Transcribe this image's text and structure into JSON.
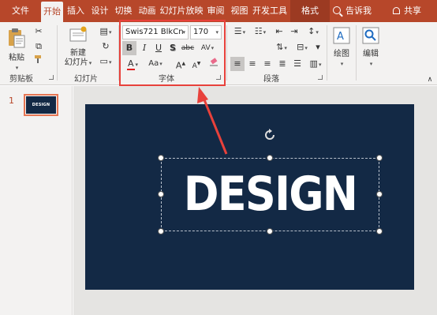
{
  "tabs": [
    "文件",
    "开始",
    "插入",
    "设计",
    "切换",
    "动画",
    "幻灯片放映",
    "审阅",
    "视图",
    "开发工具",
    "格式"
  ],
  "tell_me": "告诉我",
  "share": "共享",
  "groups": {
    "clipboard": {
      "label": "剪贴板",
      "paste": "粘贴"
    },
    "slides": {
      "label": "幻灯片",
      "new_slide_line1": "新建",
      "new_slide_line2": "幻灯片"
    },
    "font": {
      "label": "字体",
      "font_name": "Swis721 BlkCn",
      "font_size": "170",
      "bold": "B",
      "italic": "I",
      "underline": "U",
      "shadow": "S",
      "strike": "abc",
      "spacing": "AV",
      "font_color": "A",
      "change_case": "Aa",
      "grow": "A",
      "shrink": "A"
    },
    "paragraph": {
      "label": "段落"
    },
    "drawing": {
      "label": "绘图"
    },
    "editing": {
      "label": "编辑"
    }
  },
  "thumbnail": {
    "number": "1",
    "text": "DESIGN"
  },
  "slide": {
    "title_text": "DESIGN"
  },
  "colors": {
    "accent": "#b7472a",
    "slide_bg": "#132945",
    "highlight": "#e8413b"
  }
}
